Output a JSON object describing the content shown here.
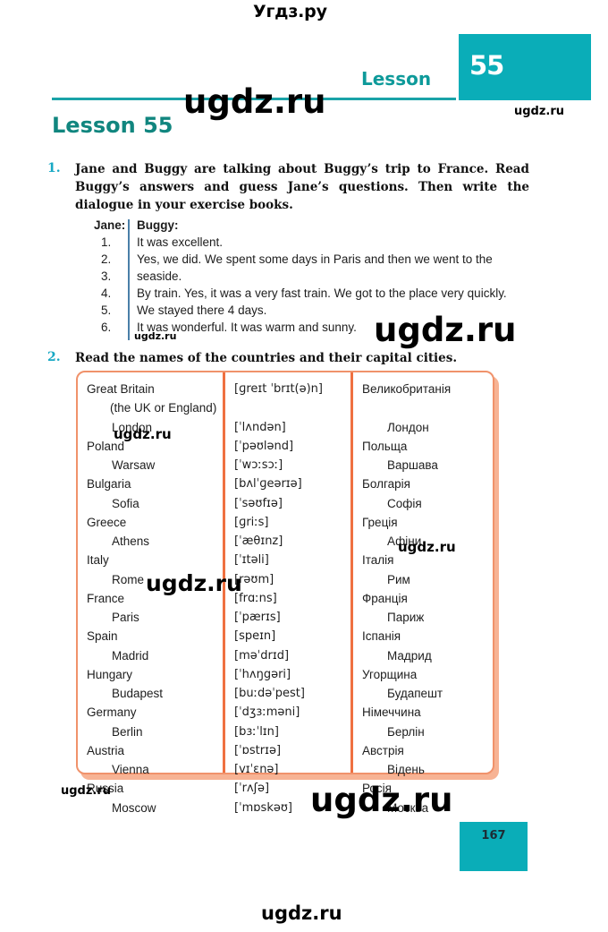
{
  "watermarks": {
    "top": "Угдз.ру",
    "brand": "ugdz.ru"
  },
  "header": {
    "lesson_word": "Lesson",
    "lesson_number": "55",
    "title": "Lesson 55"
  },
  "exercise1": {
    "number": "1.",
    "instruction": "Jane and Buggy are talking about Buggy’s trip to France. Read Buggy’s answers and guess Jane’s questions. Then write the dialogue in your exercise books.",
    "col_jane": "Jane:",
    "col_buggy": "Buggy:",
    "rows": [
      {
        "n": "1.",
        "answer": "It was excellent."
      },
      {
        "n": "2.",
        "answer": "Yes, we did. We spent some days in Paris and then we went to the"
      },
      {
        "n": "3.",
        "answer": "seaside."
      },
      {
        "n": "4.",
        "answer": "By train. Yes, it was a very fast train. We got to the place very quickly."
      },
      {
        "n": "5.",
        "answer": "We stayed there 4 days."
      },
      {
        "n": "6.",
        "answer": "It was wonderful. It was warm and sunny."
      }
    ]
  },
  "exercise2": {
    "number": "2.",
    "instruction": "Read the names of the countries and their capital cities.",
    "english": [
      "Great Britain",
      "(the UK or England)",
      "London",
      "Poland",
      "Warsaw",
      "Bulgaria",
      "Sofia",
      "Greece",
      "Athens",
      "Italy",
      "Rome",
      "France",
      "Paris",
      "Spain",
      "Madrid",
      "Hungary",
      "Budapest",
      "Germany",
      "Berlin",
      "Austria",
      "Vienna",
      "Russia",
      "Moscow"
    ],
    "ipa": [
      "[ɡreɪt ˈbrɪt(ə)n]",
      "",
      "[ˈlʌndən]",
      "[ˈpəʊlənd]",
      "[ˈwɔːsɔː]",
      "[bʌlˈɡeərɪə]",
      "[ˈsəʊfɪə]",
      "[ɡriːs]",
      "[ˈæθɪnz]",
      "[ˈɪtəli]",
      "[rəʊm]",
      "[frɑːns]",
      "[ˈpærɪs]",
      "[speɪn]",
      "[məˈdrɪd]",
      "[ˈhʌŋgəri]",
      "[buːdəˈpest]",
      "[ˈdʒɜːməni]",
      "[bɜːˈlɪn]",
      "[ˈɒstrɪə]",
      "[vɪˈɛnə]",
      "[ˈrʌʃə]",
      "[ˈmɒskəʊ]"
    ],
    "ukrainian": [
      "Великобританія",
      "",
      "Лондон",
      "Польща",
      "Варшава",
      "Болгарія",
      "Софія",
      "Греція",
      "Афіни",
      "Італія",
      "Рим",
      "Франція",
      "Париж",
      "Іспанія",
      "Мадрид",
      "Угорщина",
      "Будапешт",
      "Німеччина",
      "Берлін",
      "Австрія",
      "Відень",
      "Росія",
      "Москва"
    ],
    "indent_flags": [
      0,
      1,
      1,
      0,
      1,
      0,
      1,
      0,
      1,
      0,
      1,
      0,
      1,
      0,
      1,
      0,
      1,
      0,
      1,
      0,
      1,
      0,
      1
    ]
  },
  "page": {
    "number": "167"
  },
  "colors": {
    "teal": "#0aadb8",
    "teal_dark": "#11867f",
    "orange_border": "#f0926b",
    "orange_divider": "#ef7041",
    "exercise_number": "#17a8c4"
  }
}
